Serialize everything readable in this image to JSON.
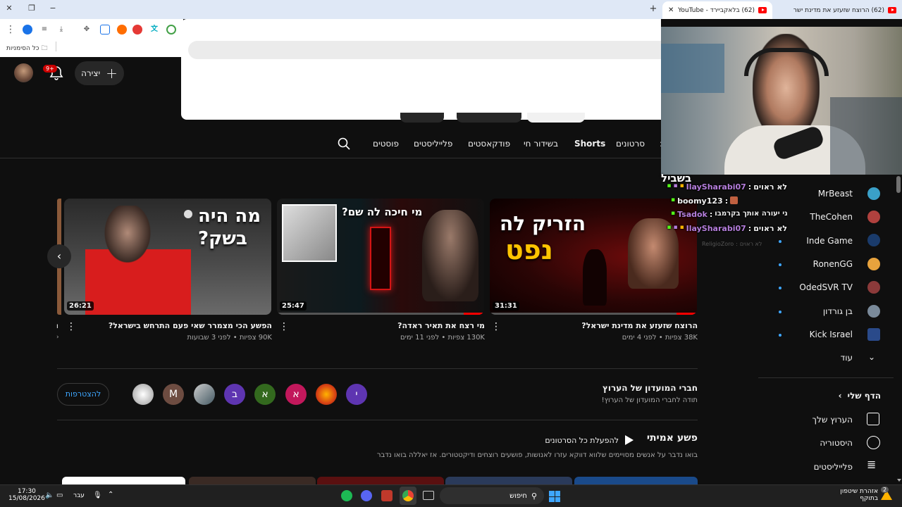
{
  "browser": {
    "tabs": [
      {
        "label": "(62) הרוצח שזעזע את מדינת ישר",
        "active": false
      },
      {
        "label": "(62) בלאקביירד - YouTube",
        "active": true
      }
    ],
    "bookmarks_label": "כל הסימניות"
  },
  "header": {
    "create_label": "יצירה",
    "notif_count": "9+"
  },
  "channel_tabs": [
    "סרטונים",
    "Shorts",
    "בשידור חי",
    "פודקאסטים",
    "פלייליסטים",
    "פוסטים"
  ],
  "videos": [
    {
      "title": "הרוצח שזעזע את מדינת ישראל?",
      "views": "38K צפיות",
      "age": "לפני 4 ימים",
      "duration": "31:31",
      "thumb_text_1": "הזריק לה",
      "thumb_text_2": "נפט",
      "progress": 0.1
    },
    {
      "title": "מי רצח את תאיר ראדה?",
      "views": "130K צפיות",
      "age": "לפני 11 ימים",
      "duration": "25:47",
      "thumb_text_1": "מי חיכה לה שם?",
      "progress": 0.1
    },
    {
      "title": "הפשע הכי מצמרר שאי פעם התרחש בישראל?",
      "views": "90K צפיות",
      "age": "לפני 3 שבועות",
      "duration": "26:21",
      "thumb_text_1": "מה היה",
      "thumb_text_2": "בשק?",
      "progress": 0
    }
  ],
  "members": {
    "title": "חברי המועדון של הערוץ",
    "subtitle": "תודה לחברי המועדון של הערוץ!",
    "join_label": "להצטרפות",
    "avatars": [
      {
        "letter": "י",
        "color": "#5e35b1"
      },
      {
        "letter": "",
        "color": "#d84315"
      },
      {
        "letter": "א",
        "color": "#c2185b"
      },
      {
        "letter": "א",
        "color": "#33691e"
      },
      {
        "letter": "ב",
        "color": "#5e35b1"
      },
      {
        "letter": "",
        "color": "#607d8b"
      },
      {
        "letter": "M",
        "color": "#6d4c41"
      },
      {
        "letter": "",
        "color": "#bdbdbd"
      }
    ]
  },
  "shelf": {
    "title": "פשע אמיתי",
    "play_all": "להפעלת כל הסרטונים",
    "description": "בואו נדבר על אנשים מסויימים שלווא דווקא עזרו לאנושות, פושעים רוצחים ודיקטטורים. אז יאללה בואו נדבר"
  },
  "sidebar": {
    "subscriptions": [
      {
        "name": "MrBeast",
        "color": "#3aa0c8"
      },
      {
        "name": "TheCohen",
        "color": "#b0413e"
      },
      {
        "name": "Inde Game",
        "color": "#1a3b6b"
      },
      {
        "name": "RonenGG",
        "color": "#e8a33d"
      },
      {
        "name": "OdedSVR TV",
        "color": "#8b3a3a"
      },
      {
        "name": "בן גורדון",
        "color": "#7a8a9a"
      },
      {
        "name": "Kick Israel",
        "color": "#2a4a8a"
      }
    ],
    "more_label": "עוד",
    "you_label": "הדף שלי",
    "you_items": [
      "הערוץ שלך",
      "היסטוריה",
      "פלייליסטים"
    ]
  },
  "stream_overlay": {
    "caption": "בשביל",
    "chat": [
      {
        "user": "IlaySharabi07",
        "msg": "לא ראוים",
        "user_color": "#b57edc"
      },
      {
        "user": "boomy123",
        "msg": "",
        "user_color": "#ffffff"
      },
      {
        "user": "Tsadok",
        "msg": "עודך באטאחה מעויין שאני יעורה אותך בקרמבו",
        "user_color": "#b57edc"
      },
      {
        "user": "IlaySharabi07",
        "msg": "לא ראוים",
        "user_color": "#b57edc"
      },
      {
        "user": "ReligioZoro",
        "msg": "לא ראוים",
        "user_color": "#555555"
      }
    ]
  },
  "taskbar": {
    "time": "17:30",
    "date": "15/08/2026",
    "lang": "עבר",
    "search": "חיפוש",
    "notif_title": "אזהרת שיטפון",
    "notif_sub": "בתוקף",
    "notif_count": "2"
  }
}
